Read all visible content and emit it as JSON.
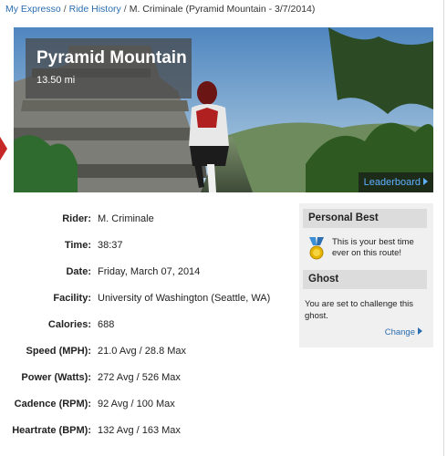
{
  "breadcrumb": {
    "items": [
      "My Expresso",
      "Ride History"
    ],
    "current": "M. Criminale (Pyramid Mountain - 3/7/2014)",
    "separator": "/"
  },
  "hero": {
    "route_name": "Pyramid Mountain",
    "distance": "13.50 mi",
    "leaderboard_label": "Leaderboard"
  },
  "stats": [
    {
      "label": "Rider:",
      "value": "M. Criminale"
    },
    {
      "label": "Time:",
      "value": "38:37"
    },
    {
      "label": "Date:",
      "value": "Friday, March 07, 2014"
    },
    {
      "label": "Facility:",
      "value": "University of Washington (Seattle, WA)"
    },
    {
      "label": "Calories:",
      "value": "688"
    },
    {
      "label": "Speed (MPH):",
      "value": "21.0 Avg / 28.8 Max"
    },
    {
      "label": "Power (Watts):",
      "value": "272 Avg / 526 Max"
    },
    {
      "label": "Cadence (RPM):",
      "value": "92 Avg / 100 Max"
    },
    {
      "label": "Heartrate (BPM):",
      "value": "132 Avg / 163 Max"
    }
  ],
  "personal_best": {
    "title": "Personal Best",
    "icon": "medal-icon",
    "text": "This is your best time ever on this route!"
  },
  "ghost": {
    "title": "Ghost",
    "text": "You are set to challenge this ghost.",
    "change_label": "Change"
  },
  "colors": {
    "link": "#2a6db0",
    "leaderboard": "#5fb0ff",
    "panel_bg": "#f0f0f0",
    "panel_header": "#dcdcdc"
  }
}
